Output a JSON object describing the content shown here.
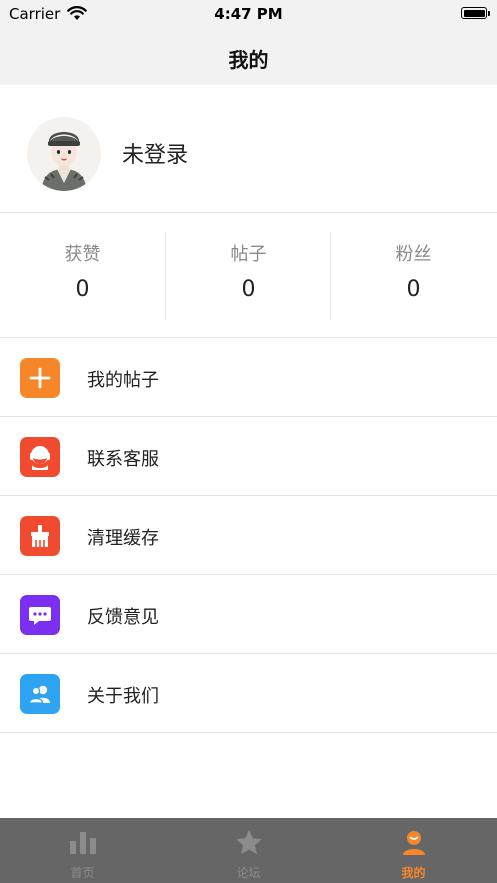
{
  "status_bar": {
    "carrier": "Carrier",
    "time": "4:47 PM"
  },
  "nav": {
    "title": "我的"
  },
  "profile": {
    "username": "未登录"
  },
  "stats": [
    {
      "label": "获赞",
      "value": "0"
    },
    {
      "label": "帖子",
      "value": "0"
    },
    {
      "label": "粉丝",
      "value": "0"
    }
  ],
  "menu": [
    {
      "label": "我的帖子",
      "icon": "plus-icon",
      "color": "#f7852a"
    },
    {
      "label": "联系客服",
      "icon": "customer-service-icon",
      "color": "#f04a2f"
    },
    {
      "label": "清理缓存",
      "icon": "broom-icon",
      "color": "#f04a2f"
    },
    {
      "label": "反馈意见",
      "icon": "chat-bubble-icon",
      "color": "#7b2ff0"
    },
    {
      "label": "关于我们",
      "icon": "users-icon",
      "color": "#2ea3f2"
    }
  ],
  "tabbar": {
    "items": [
      {
        "label": "首页",
        "icon": "bar-chart-icon"
      },
      {
        "label": "论坛",
        "icon": "star-icon"
      },
      {
        "label": "我的",
        "icon": "person-icon",
        "active": true
      }
    ],
    "active_color": "#f5862a",
    "inactive_color": "#8c8c8c"
  }
}
